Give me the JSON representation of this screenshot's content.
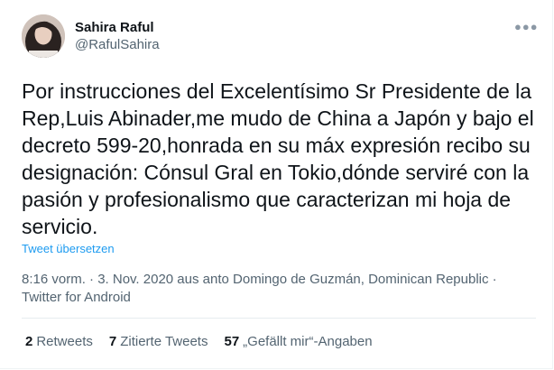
{
  "user": {
    "display_name": "Sahira Raful",
    "handle": "@RafulSahira"
  },
  "tweet": {
    "text": "Por instrucciones del Excelentísimo Sr Presidente de la\nRep,Luis Abinader,me mudo de China a Japón y bajo el\ndecreto 599-20,honrada en su máx expresión recibo su\ndesignación: Cónsul Gral en Tokio,dónde serviré con la\npasión y profesionalismo que caracterizan mi hoja de\nservicio.",
    "translate_label": "Tweet übersetzen"
  },
  "meta": {
    "line1": "8:16 vorm. · 3. Nov. 2020 aus anto Domingo de Guzmán, Dominican Republic ·",
    "line2": "Twitter for Android"
  },
  "stats": {
    "retweets_count": "2",
    "retweets_label": "Retweets",
    "quotes_count": "7",
    "quotes_label": "Zitierte Tweets",
    "likes_count": "57",
    "likes_label": "„Gefällt mir“-Angaben"
  },
  "icons": {
    "more": "more-options-icon"
  }
}
